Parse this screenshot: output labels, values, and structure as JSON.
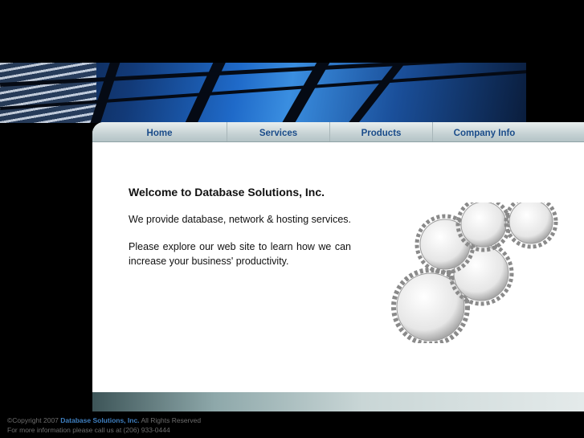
{
  "nav": {
    "items": [
      {
        "label": "Home"
      },
      {
        "label": "Services"
      },
      {
        "label": "Products"
      },
      {
        "label": "Company Info"
      }
    ]
  },
  "content": {
    "heading": "Welcome to Database Solutions, Inc.",
    "paragraph1": "We provide database, network & hosting services.",
    "paragraph2": "Please explore our web site to learn how we can increase your business' productivity."
  },
  "footer": {
    "copyright_prefix": "©Copyright 2007",
    "company_name": "Database Solutions, Inc.",
    "rights": "All Rights Reserved",
    "contact": "For more information please call us at (206) 933-0444"
  },
  "colors": {
    "nav_text": "#1a4c8a",
    "footer_link": "#3f7fbf"
  }
}
